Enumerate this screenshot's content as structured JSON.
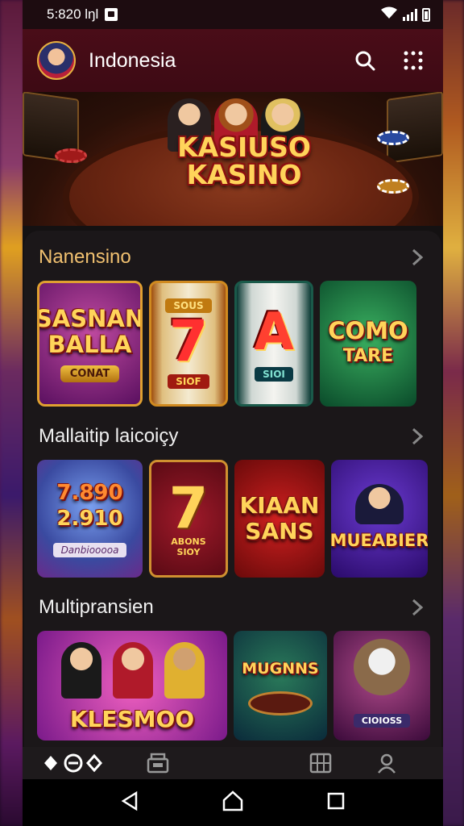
{
  "status_bar": {
    "time": "5:820 lŋl",
    "notification_icon": "notification-square-icon",
    "wifi_icon": "wifi-icon",
    "signal_icon": "signal-bars-icon",
    "battery_icon": "battery-icon"
  },
  "header": {
    "title": "Indonesia",
    "search_icon": "search-icon",
    "menu_icon": "grid-dots-icon"
  },
  "hero": {
    "logo_line1": "KASIUSO",
    "logo_line2": "KASINO"
  },
  "sections": [
    {
      "title": "Nanensino",
      "tiles": [
        {
          "line1": "SASNAN",
          "line2": "BALLA",
          "pill": "CONAT"
        },
        {
          "top": "SOUS",
          "symbol": "7",
          "bottom": "SIOF"
        },
        {
          "symbol": "A",
          "bottom": "SIOI"
        },
        {
          "line1": "COMO",
          "line2": "TARE"
        }
      ]
    },
    {
      "title": "Mallaitip laicoiçy",
      "tiles": [
        {
          "line1": "7.890",
          "line2": "2.910",
          "button": "Danbiooooa"
        },
        {
          "symbol": "7",
          "line1": "ABONS",
          "line2": "SIOY"
        },
        {
          "line1": "KIAAN",
          "line2": "SANS"
        },
        {
          "line1": "MUEABIER"
        }
      ]
    },
    {
      "title": "Multipransien",
      "tiles": [
        {
          "line1": "KLESMOO"
        },
        {
          "line1": "MUGNNS"
        },
        {
          "line1": "CIOIOSS"
        }
      ]
    }
  ],
  "bottom_nav": [
    {
      "icon": "diamond-chips-icon"
    },
    {
      "icon": "cashier-icon"
    },
    {
      "icon": "slot-machine-icon"
    },
    {
      "icon": "profile-icon"
    }
  ],
  "system_nav": {
    "back_icon": "back-triangle-icon",
    "home_icon": "home-icon",
    "recents_icon": "recents-square-icon"
  },
  "colors": {
    "header_bg": "#3d0a14",
    "accent_gold": "#ffd45a",
    "background": "#141112"
  }
}
